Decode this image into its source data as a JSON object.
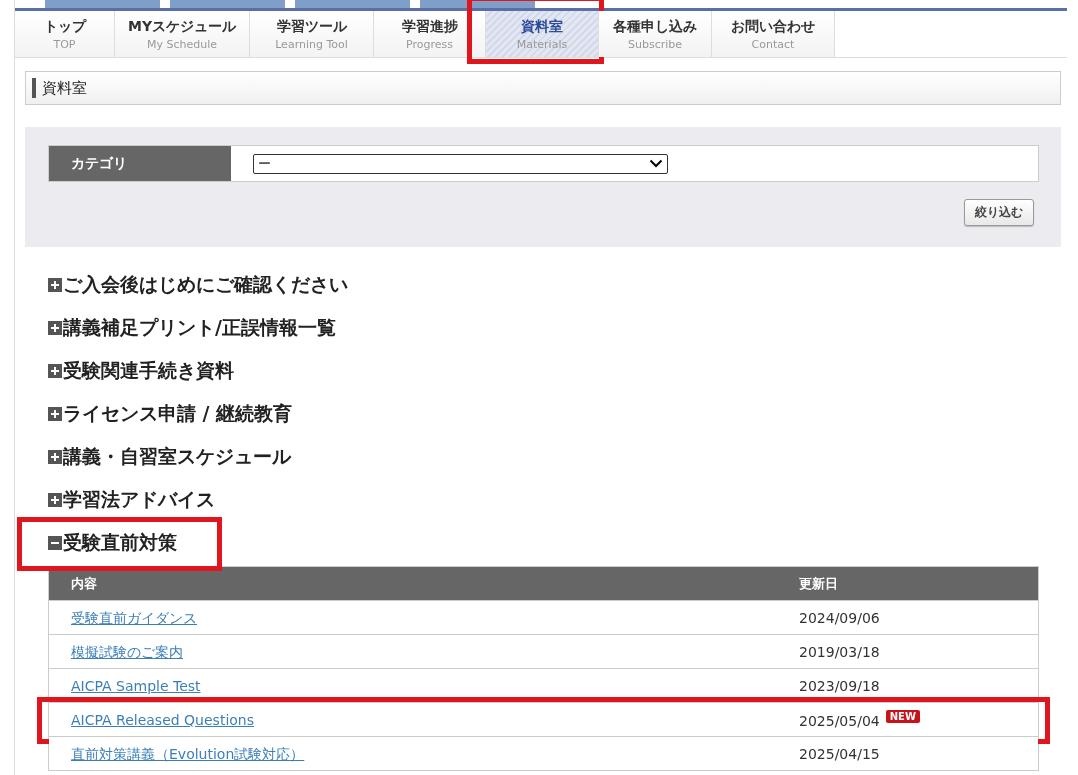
{
  "nav_tabs": [
    {
      "label": "トップ",
      "sublabel": "TOP",
      "selected": false,
      "highlighted": false
    },
    {
      "label": "MYスケジュール",
      "sublabel": "My Schedule",
      "selected": false,
      "highlighted": false
    },
    {
      "label": "学習ツール",
      "sublabel": "Learning Tool",
      "selected": false,
      "highlighted": false
    },
    {
      "label": "学習進捗",
      "sublabel": "Progress",
      "selected": false,
      "highlighted": false
    },
    {
      "label": "資料室",
      "sublabel": "Materials",
      "selected": true,
      "highlighted": true
    },
    {
      "label": "各種申し込み",
      "sublabel": "Subscribe",
      "selected": false,
      "highlighted": false
    },
    {
      "label": "お問い合わせ",
      "sublabel": "Contact",
      "selected": false,
      "highlighted": false
    }
  ],
  "page_title": "資料室",
  "filter": {
    "label": "カテゴリ",
    "value": "ー",
    "button": "絞り込む"
  },
  "sections": [
    {
      "title": "ご入会後はじめにご確認ください",
      "expanded": false,
      "highlighted": false
    },
    {
      "title": "講義補足プリント/正誤情報一覧",
      "expanded": false,
      "highlighted": false
    },
    {
      "title": "受験関連手続き資料",
      "expanded": false,
      "highlighted": false
    },
    {
      "title": "ライセンス申請 / 継続教育",
      "expanded": false,
      "highlighted": false
    },
    {
      "title": "講義・自習室スケジュール",
      "expanded": false,
      "highlighted": false
    },
    {
      "title": "学習法アドバイス",
      "expanded": false,
      "highlighted": false
    },
    {
      "title": "受験直前対策",
      "expanded": true,
      "highlighted": true,
      "table": {
        "columns": [
          "内容",
          "更新日"
        ],
        "rows": [
          {
            "title": "受験直前ガイダンス",
            "date": "2024/09/06",
            "highlighted": false
          },
          {
            "title": "模擬試験のご案内",
            "date": "2019/03/18",
            "highlighted": false
          },
          {
            "title": "AICPA Sample Test",
            "date": "2023/09/18",
            "highlighted": false
          },
          {
            "title": "AICPA Released Questions",
            "date": "2025/05/04",
            "badge": "NEW",
            "highlighted": true
          },
          {
            "title": "直前対策講義（Evolution試験対応）",
            "date": "2025/04/15",
            "highlighted": false
          }
        ]
      }
    }
  ]
}
